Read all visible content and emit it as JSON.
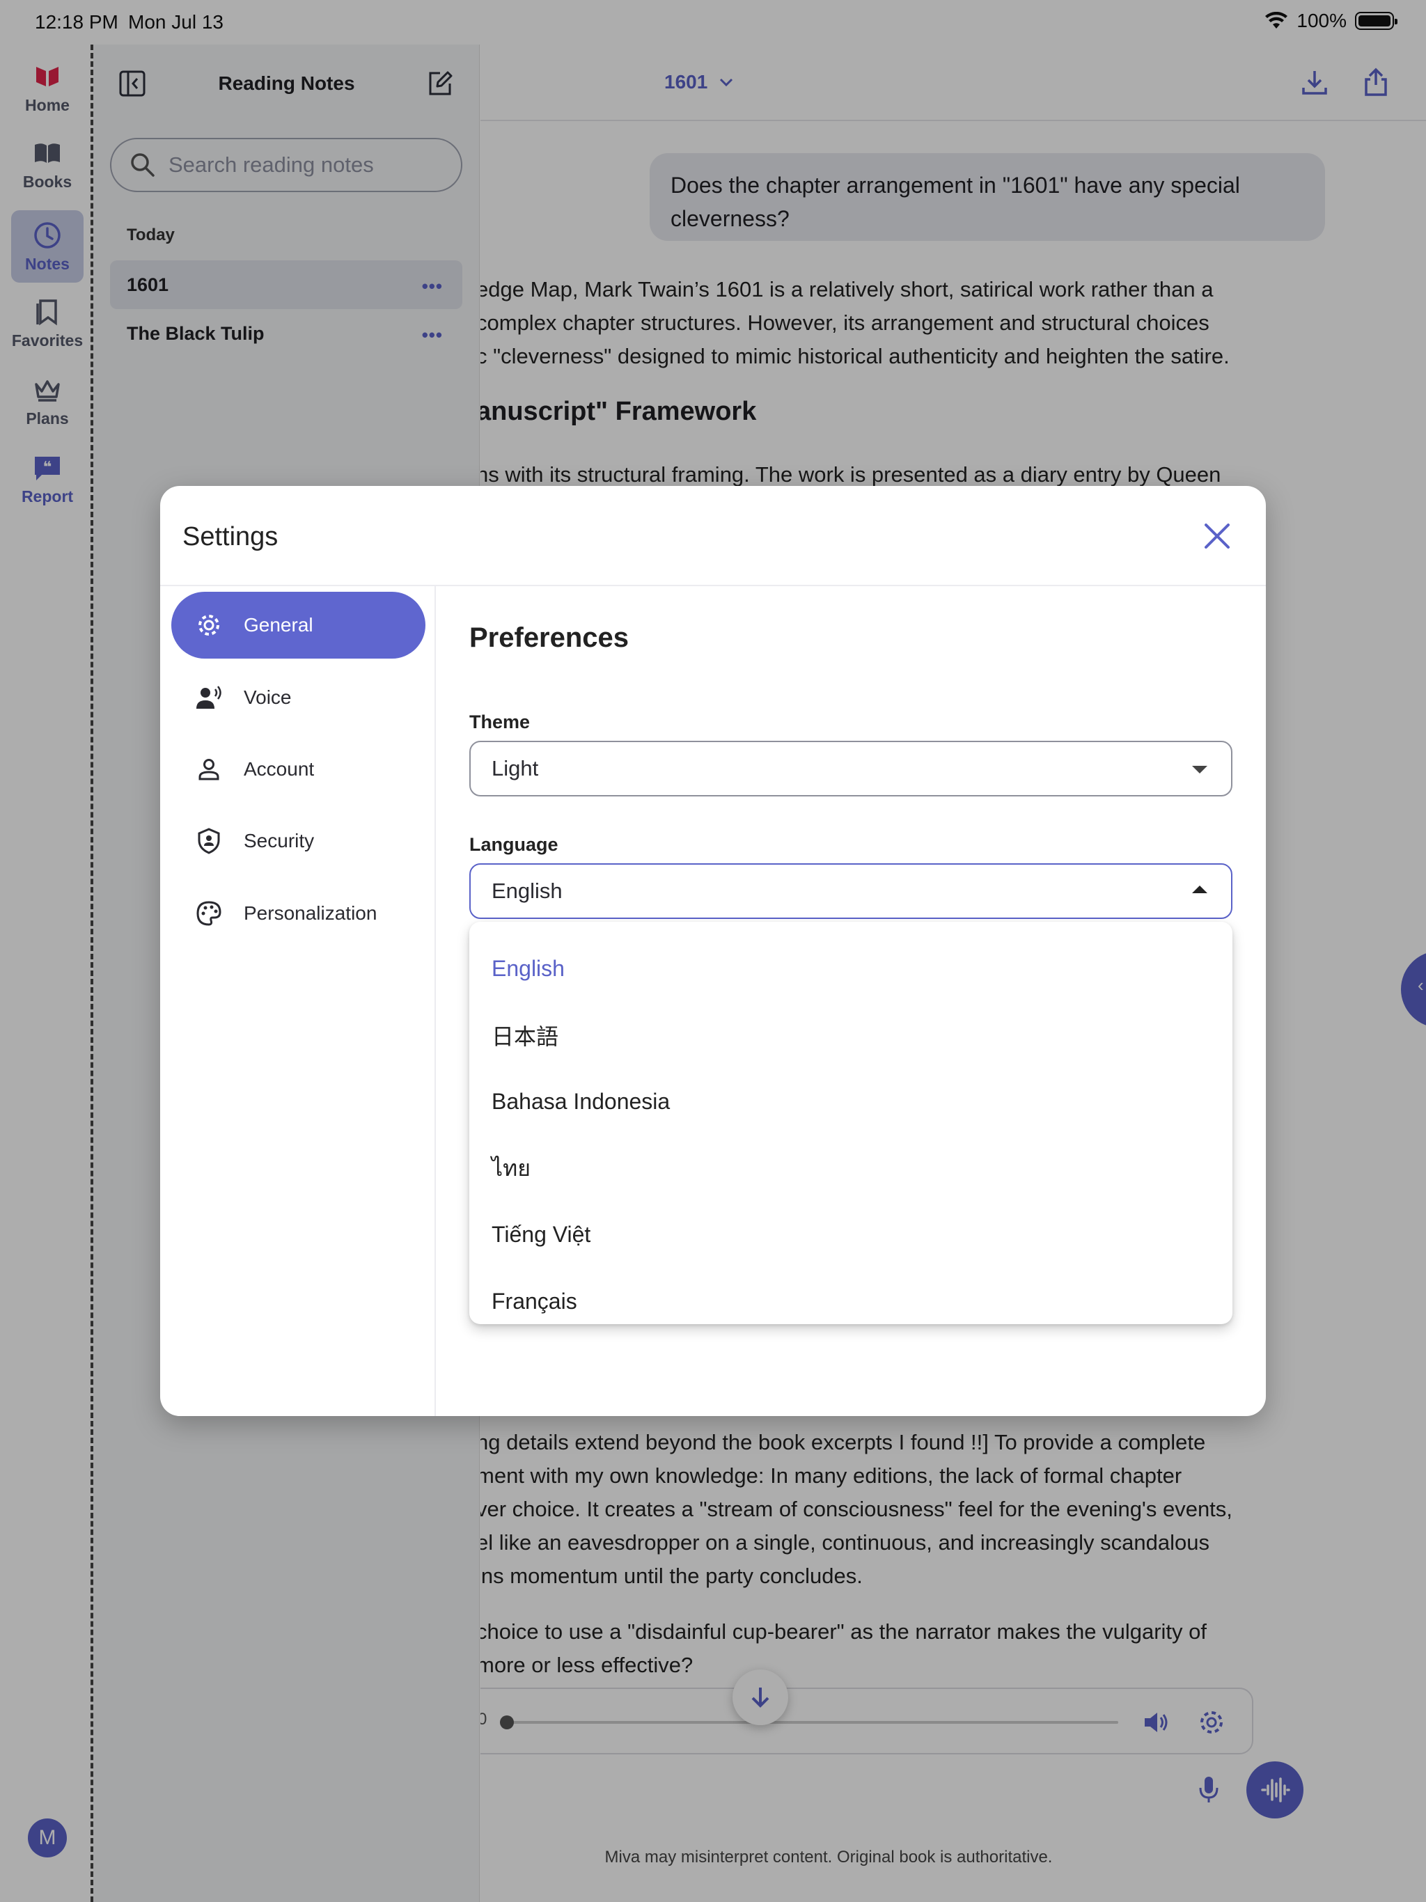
{
  "status_bar": {
    "time": "12:18 PM",
    "date": "Mon Jul 13",
    "battery": "100%"
  },
  "rail": {
    "items": [
      {
        "label": "Home",
        "icon": "book-logo-icon"
      },
      {
        "label": "Books",
        "icon": "book-open-icon"
      },
      {
        "label": "Notes",
        "icon": "clock-icon",
        "active": true
      },
      {
        "label": "Favorites",
        "icon": "bookmark-icon"
      },
      {
        "label": "Plans",
        "icon": "crown-icon"
      },
      {
        "label": "Report",
        "icon": "quote-bubble-icon"
      }
    ],
    "avatar_initial": "M"
  },
  "notes_panel": {
    "title": "Reading Notes",
    "search_placeholder": "Search reading notes",
    "section": "Today",
    "notes": [
      {
        "title": "1601",
        "selected": true
      },
      {
        "title": "The Black Tulip",
        "selected": false
      }
    ],
    "more_glyph": "•••"
  },
  "main": {
    "book": "1601",
    "user_message": "Does the chapter arrangement in \"1601\" have any special cleverness?",
    "answer_lines": [
      "edge Map, Mark Twain’s 1601 is a relatively short, satirical work rather than a",
      " complex chapter structures. However, its arrangement and structural choices",
      "c \"cleverness\" designed to mimic historical authenticity and heighten the satire."
    ],
    "heading": "anuscript\" Framework",
    "para2": "ns with its structural framing. The work is presented as a diary entry by Queen",
    "lower_lines": [
      "ng details extend beyond the book excerpts I found !!] To provide a complete",
      "ment with my own knowledge: In many editions, the lack of formal chapter",
      "ver choice. It creates a \"stream of consciousness\" feel for the evening's events,",
      "el like an eavesdropper on a single, continuous, and increasingly scandalous",
      "ins momentum until the party concludes."
    ],
    "followup_lines": [
      " choice to use a \"disdainful cup-bearer\" as the narrator makes the vulgarity of",
      " more or less effective?"
    ],
    "player_time": "0",
    "disclaimer": "Miva may misinterpret content. Original book is authoritative."
  },
  "settings": {
    "title": "Settings",
    "nav": [
      {
        "label": "General",
        "icon": "gear-icon",
        "active": true
      },
      {
        "label": "Voice",
        "icon": "voice-icon"
      },
      {
        "label": "Account",
        "icon": "person-icon"
      },
      {
        "label": "Security",
        "icon": "shield-icon"
      },
      {
        "label": "Personalization",
        "icon": "palette-icon"
      }
    ],
    "section_title": "Preferences",
    "theme": {
      "label": "Theme",
      "value": "Light"
    },
    "language": {
      "label": "Language",
      "value": "English",
      "options": [
        "English",
        "日本語",
        "Bahasa Indonesia",
        "ไทย",
        "Tiếng Việt",
        "Français"
      ]
    }
  },
  "colors": {
    "accent": "#5a62c8",
    "accent_active": "#5f66cf",
    "scrim": "rgba(0,0,0,0.32)"
  }
}
